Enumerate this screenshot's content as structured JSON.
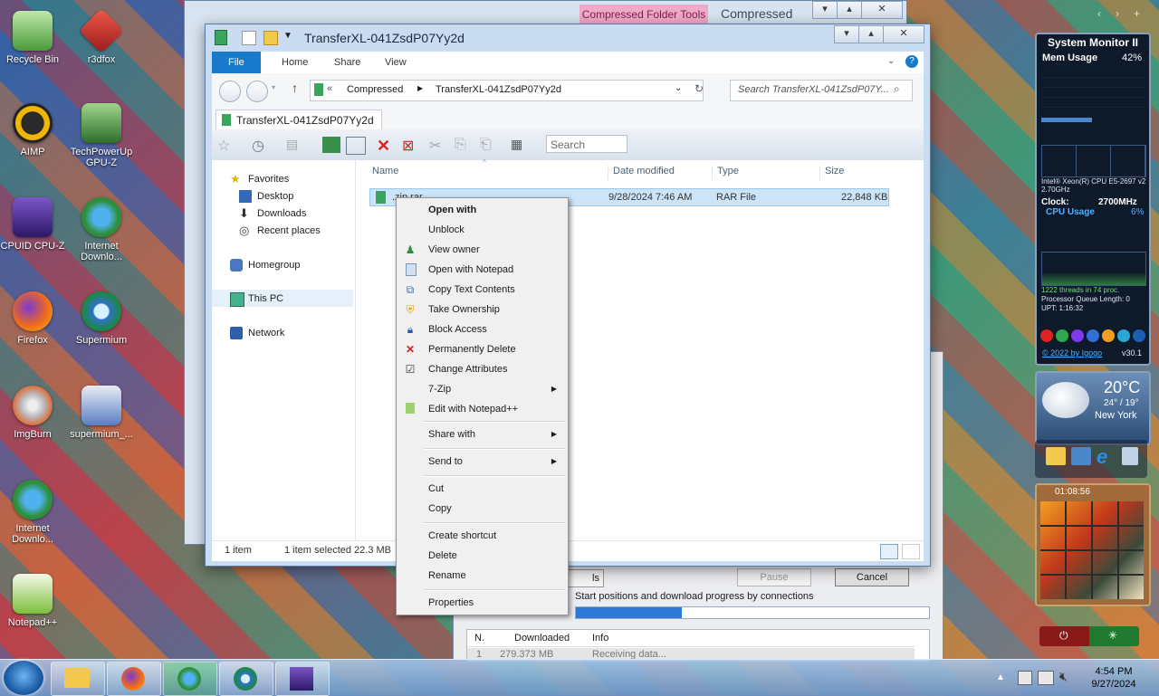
{
  "desktop_icons": [
    {
      "label": "Recycle Bin",
      "icon": "recycle-bin-icon",
      "color": "#6fbf4a"
    },
    {
      "label": "r3dfox",
      "icon": "r3dfox-icon",
      "color": "#d63b3b"
    },
    {
      "label": "AIMP",
      "icon": "aimp-icon",
      "color": "#f2b705"
    },
    {
      "label": "TechPowerUp GPU-Z",
      "icon": "gpuz-icon",
      "color": "#3c8c3c"
    },
    {
      "label": "CPUID CPU-Z",
      "icon": "cpuz-icon",
      "color": "#4a2a8a"
    },
    {
      "label": "Internet Downlo...",
      "icon": "idm-icon",
      "color": "#2d8f3a"
    },
    {
      "label": "Firefox",
      "icon": "firefox-icon",
      "color": "#f06a1c"
    },
    {
      "label": "Supermium",
      "icon": "supermium-icon",
      "color": "#2c72c4"
    },
    {
      "label": "ImgBurn",
      "icon": "imgburn-icon",
      "color": "#c84a1c"
    },
    {
      "label": "supermium_...",
      "icon": "installer-icon",
      "color": "#5a7ec4"
    },
    {
      "label": "Internet Downlo...",
      "icon": "idm-icon",
      "color": "#2d8f3a"
    },
    {
      "label": "Notepad++",
      "icon": "notepadpp-icon",
      "color": "#7cbf3a"
    }
  ],
  "back_window": {
    "context_tab": "Compressed Folder Tools",
    "title": "Compressed"
  },
  "explorer": {
    "title": "TransferXL-041ZsdP07Yy2d",
    "ribbon_tabs": [
      "File",
      "Home",
      "Share",
      "View"
    ],
    "address": {
      "parent": "Compressed",
      "current": "TransferXL-041ZsdP07Yy2d"
    },
    "search_placeholder": "Search TransferXL-041ZsdP07Y...",
    "tab_label": "TransferXL-041ZsdP07Yy2d",
    "toolbar_search": "Search",
    "nav": {
      "favorites": "Favorites",
      "desktop": "Desktop",
      "downloads": "Downloads",
      "recent": "Recent places",
      "homegroup": "Homegroup",
      "this_pc": "This PC",
      "network": "Network"
    },
    "columns": {
      "name": "Name",
      "date": "Date modified",
      "type": "Type",
      "size": "Size"
    },
    "file": {
      "name": ".zip.rar",
      "date": "9/28/2024 7:46 AM",
      "type": "RAR File",
      "size": "22,848 KB"
    },
    "status": {
      "count": "1 item",
      "selected": "1 item selected  22.3 MB"
    }
  },
  "context_menu": {
    "items": [
      {
        "label": "Open with",
        "bold": true,
        "icon": ""
      },
      {
        "label": "Unblock",
        "icon": ""
      },
      {
        "label": "View owner",
        "icon": "user-icon"
      },
      {
        "label": "Open with Notepad",
        "icon": "notepad-icon"
      },
      {
        "label": "Copy Text Contents",
        "icon": "copy-text-icon"
      },
      {
        "label": "Take Ownership",
        "icon": "shield-icon"
      },
      {
        "label": "Block Access",
        "icon": "lock-icon"
      },
      {
        "label": "Permanently Delete",
        "icon": "red-x-icon"
      },
      {
        "label": "Change Attributes",
        "icon": "check-circle-icon"
      },
      {
        "label": "7-Zip",
        "icon": "",
        "submenu": true
      },
      {
        "label": "Edit with Notepad++",
        "icon": "notepadpp-icon"
      },
      {
        "label": "Share with",
        "icon": "",
        "submenu": true
      },
      {
        "label": "Send to",
        "icon": "",
        "submenu": true
      },
      {
        "label": "Cut",
        "icon": ""
      },
      {
        "label": "Copy",
        "icon": ""
      },
      {
        "label": "Create shortcut",
        "icon": ""
      },
      {
        "label": "Delete",
        "icon": ""
      },
      {
        "label": "Rename",
        "icon": ""
      },
      {
        "label": "Properties",
        "icon": ""
      }
    ]
  },
  "idm_window": {
    "tab_partial": "ls",
    "pause": "Pause",
    "cancel": "Cancel",
    "caption": "Start positions and download progress by connections",
    "progress_fraction": 0.3,
    "columns": [
      "N.",
      "Downloaded",
      "Info"
    ],
    "rows": [
      {
        "n": "1",
        "downloaded": "279.373 MB",
        "info": "Receiving data..."
      }
    ]
  },
  "system_monitor": {
    "title": "System Monitor II",
    "mem_label": "Mem Usage",
    "mem_pct": "42%",
    "clock_label": "Clock:",
    "clock_value": "2700MHz",
    "cpu_label": "CPU Usage",
    "cpu_pct": "6%",
    "cpu_name": "Intel® Xeon(R) CPU E5-2697 v2 2.70GHz",
    "threads": "1222 threads in 74 proc.",
    "queue": "Processor Queue Length: 0",
    "uptime": "UPT: 1:16:32",
    "footer": "© 2022 by Igogo",
    "version": "v30.1"
  },
  "weather": {
    "temp": "20°C",
    "range": "24° / 19°",
    "city": "New York"
  },
  "puzzle": {
    "timer": "01:08:56"
  },
  "taskbar": {
    "time": "4:54 PM",
    "date": "9/27/2024"
  }
}
